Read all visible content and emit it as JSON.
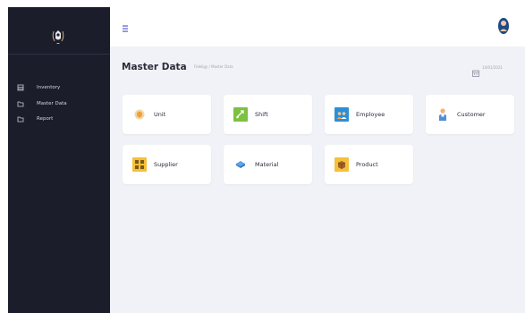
{
  "sidebar": {
    "logo_name": "emblem-logo",
    "items": [
      {
        "label": "Inventory",
        "icon": "inventory-icon"
      },
      {
        "label": "Master Data",
        "icon": "folder-icon"
      },
      {
        "label": "Report",
        "icon": "report-icon"
      }
    ]
  },
  "topbar": {
    "menu_icon": "hamburger-icon",
    "avatar_icon": "user-avatar-icon"
  },
  "main": {
    "title": "Master Data",
    "breadcrumb": "Fideligy / Master Data",
    "date": "14/01/2021"
  },
  "cards": [
    {
      "label": "Unit",
      "icon": "unit-icon"
    },
    {
      "label": "Shift",
      "icon": "shift-icon"
    },
    {
      "label": "Employee",
      "icon": "employee-icon"
    },
    {
      "label": "Customer",
      "icon": "customer-icon"
    },
    {
      "label": "Supplier",
      "icon": "supplier-icon"
    },
    {
      "label": "Material",
      "icon": "material-icon"
    },
    {
      "label": "Product",
      "icon": "product-icon"
    }
  ],
  "colors": {
    "sidebar_bg": "#1c1d2b",
    "main_bg": "#f1f2f7",
    "accent": "#4a4ac4"
  }
}
